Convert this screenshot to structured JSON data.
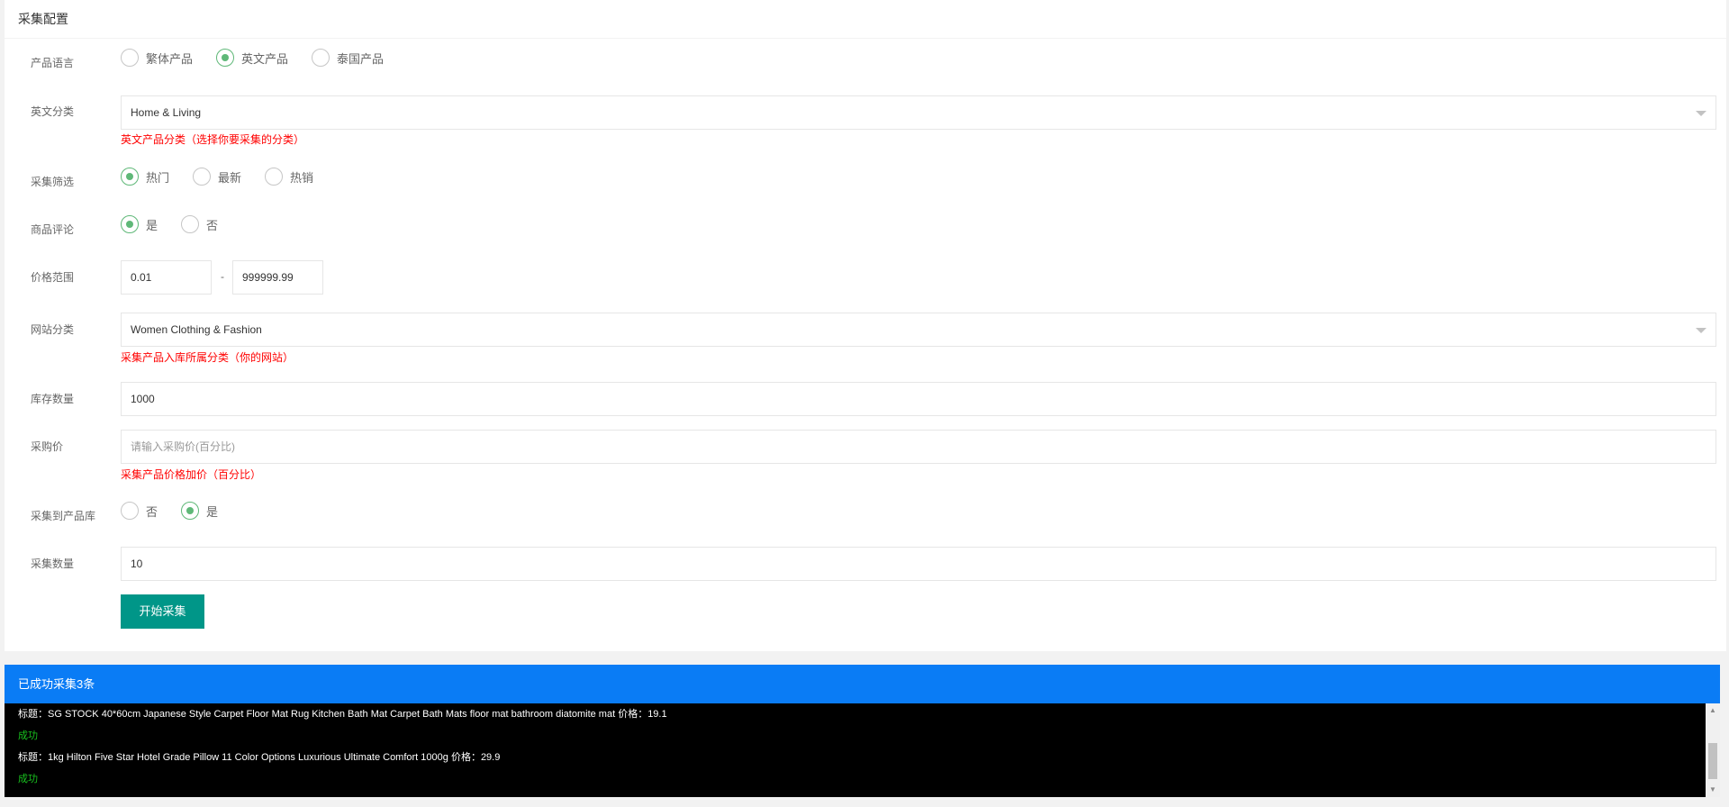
{
  "panel": {
    "title": "采集配置"
  },
  "form": {
    "language": {
      "label": "产品语言",
      "options": [
        "繁体产品",
        "英文产品",
        "泰国产品"
      ],
      "selected": 1
    },
    "en_category": {
      "label": "英文分类",
      "value": "Home & Living",
      "hint": "英文产品分类（选择你要采集的分类）"
    },
    "filter": {
      "label": "采集筛选",
      "options": [
        "热门",
        "最新",
        "热销"
      ],
      "selected": 0
    },
    "reviews": {
      "label": "商品评论",
      "options": [
        "是",
        "否"
      ],
      "selected": 0
    },
    "price_range": {
      "label": "价格范围",
      "min": "0.01",
      "separator": "-",
      "max": "999999.99"
    },
    "site_category": {
      "label": "网站分类",
      "value": "Women Clothing & Fashion",
      "hint": "采集产品入库所属分类（你的网站）"
    },
    "stock": {
      "label": "库存数量",
      "value": "1000"
    },
    "purchase_price": {
      "label": "采购价",
      "placeholder": "请输入采购价(百分比)",
      "hint": "采集产品价格加价（百分比）"
    },
    "to_library": {
      "label": "采集到产品库",
      "options": [
        "否",
        "是"
      ],
      "selected": 1
    },
    "count": {
      "label": "采集数量",
      "value": "10"
    },
    "submit_label": "开始采集"
  },
  "log": {
    "title": "已成功采集3条",
    "lines": [
      {
        "text": "标题：SG STOCK 40*60cm Japanese Style Carpet Floor Mat Rug Kitchen Bath Mat Carpet Bath Mats floor mat bathroom diatomite mat  价格：19.1",
        "status": "info"
      },
      {
        "text": "成功",
        "status": "ok"
      },
      {
        "text": "标题：1kg Hilton Five Star Hotel Grade Pillow 11 Color Options Luxurious Ultimate Comfort 1000g  价格：29.9",
        "status": "info"
      },
      {
        "text": "成功",
        "status": "ok"
      }
    ]
  }
}
